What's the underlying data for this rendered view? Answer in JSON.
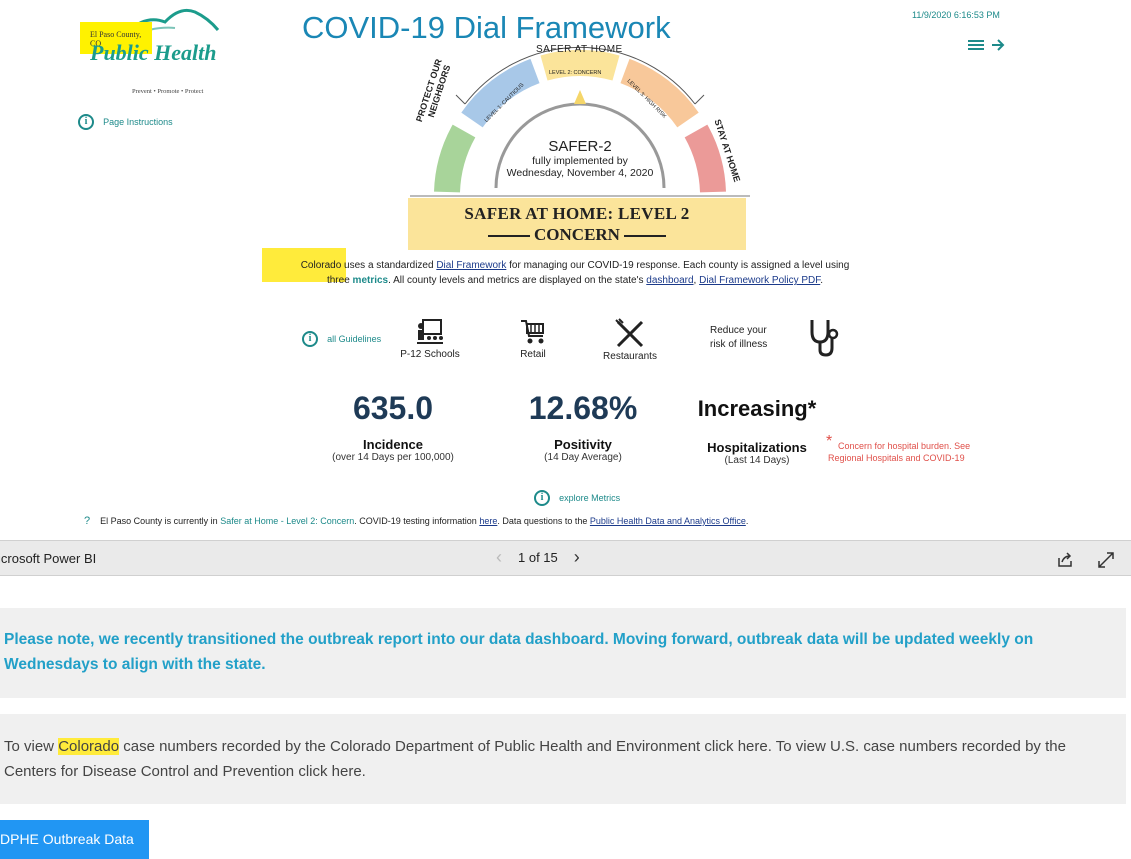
{
  "report": {
    "logo": {
      "county": "El Paso County, CO",
      "name": "Public Health",
      "tagline": "Prevent • Promote • Protect"
    },
    "title": "COVID-19 Dial Framework",
    "timestamp": "11/9/2020 6:16:53 PM",
    "page_instructions": "Page Instructions",
    "dial": {
      "top_label": "SAFER AT HOME",
      "left_label_1": "PROTECT OUR",
      "left_label_2": "NEIGHBORS",
      "right_label": "STAY AT HOME",
      "segment_1": "LEVEL 1: CAUTIOUS",
      "segment_2": "LEVEL 2: CONCERN",
      "segment_3": "LEVEL 3: HIGH RISK",
      "center_title": "SAFER-2",
      "center_sub1": "fully implemented by",
      "center_sub2": "Wednesday, November 4, 2020",
      "colors": {
        "green": "#a8d49a",
        "blue": "#a8c8e8",
        "yellow": "#fbe49a",
        "orange": "#f8c89a",
        "red": "#eb9a98"
      }
    },
    "banner": {
      "line1": "SAFER AT HOME: LEVEL 2",
      "line2": "CONCERN"
    },
    "intro": {
      "p1": "Colorado uses a standardized ",
      "link1": "Dial Framework",
      "p2": " for managing our COVID-19 response. Each county is assigned a level using",
      "p3": "three ",
      "metrics_word": "metrics",
      "p4": ". All county levels and metrics are displayed on the state's ",
      "link2": "dashboard",
      "p5": ", ",
      "link3": "Dial Framework Policy PDF",
      "p6": "."
    },
    "guidelines_label": "all Guidelines",
    "categories": [
      "P-12 Schools",
      "Retail",
      "Restaurants"
    ],
    "reduce_1": "Reduce your",
    "reduce_2": "risk of illness",
    "metrics": [
      {
        "value": "635.0",
        "label": "Incidence",
        "sub": "(over 14 Days per 100,000)"
      },
      {
        "value": "12.68%",
        "label": "Positivity",
        "sub": "(14 Day Average)"
      },
      {
        "value": "Increasing*",
        "label": "Hospitalizations",
        "sub": "(Last 14 Days)"
      }
    ],
    "concern_star": "*",
    "concern_1": "Concern for hospital burden. See",
    "concern_2": "Regional Hospitals and COVID-19",
    "explore_metrics": "explore Metrics",
    "footer": {
      "q": "?",
      "t1": "El Paso County is currently in ",
      "status": "Safer at Home - Level 2: Concern",
      "t2": ".  COVID-19 testing information ",
      "here": "here",
      "t3": ". Data questions to the ",
      "office": "Public Health Data and Analytics Office",
      "t4": "."
    },
    "accent": "#1a87b5",
    "teal": "#1d8a8a"
  },
  "pbi_bar": {
    "name": "icrosoft Power BI",
    "page_indicator": "1 of 15"
  },
  "notice1": "Please note, we recently transitioned the outbreak report into our data dashboard. Moving forward, outbreak data will be updated weekly on Wednesdays to align with the state.",
  "notice2": {
    "t1": "To view ",
    "colorado": "Colorado",
    "t2": " case numbers recorded by the Colorado Department of Public Health and Environment click here. To view U.S. case numbers recorded by the Centers for Disease Control and Prevention click here."
  },
  "cdphe_button": "DPHE Outbreak Data"
}
